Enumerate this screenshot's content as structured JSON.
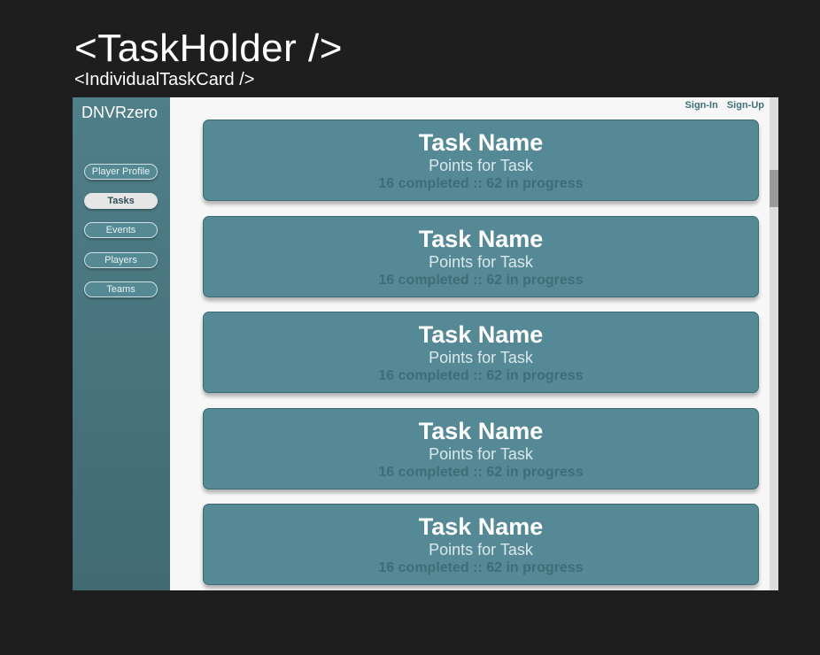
{
  "canvas": {
    "title": "<TaskHolder />",
    "subtitle": "<IndividualTaskCard />"
  },
  "app": {
    "brand": "DNVRzero",
    "top_links": {
      "sign_in": "Sign-In",
      "sign_up": "Sign-Up"
    },
    "nav": [
      {
        "label": "Player Profile",
        "active": false
      },
      {
        "label": "Tasks",
        "active": true
      },
      {
        "label": "Events",
        "active": false
      },
      {
        "label": "Players",
        "active": false
      },
      {
        "label": "Teams",
        "active": false
      }
    ],
    "tasks": [
      {
        "name": "Task Name",
        "points": "Points for Task",
        "stats": "16 completed :: 62 in progress"
      },
      {
        "name": "Task Name",
        "points": "Points for Task",
        "stats": "16 completed :: 62 in progress"
      },
      {
        "name": "Task Name",
        "points": "Points for Task",
        "stats": "16 completed :: 62 in progress"
      },
      {
        "name": "Task Name",
        "points": "Points for Task",
        "stats": "16 completed :: 62 in progress"
      },
      {
        "name": "Task Name",
        "points": "Points for Task",
        "stats": "16 completed :: 62 in progress"
      }
    ]
  },
  "colors": {
    "canvas_bg": "#1e1e1e",
    "sidebar": "#4a7a84",
    "card": "#568996",
    "content_bg": "#f7f7f7"
  }
}
